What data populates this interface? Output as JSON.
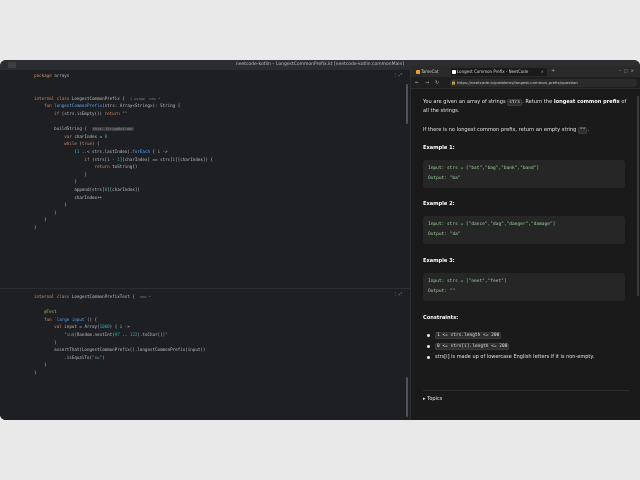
{
  "ide": {
    "window_title": "neetcode-kotlin – LongestCommonPrefix.kt [neetcode-kotlin.commonMain]",
    "top_hints": "1 usage  new *",
    "bottom_hints": "new *"
  },
  "code_top": [
    "package arrays",
    "",
    "",
    "internal class LongestCommonPrefix {",
    "    fun longestCommonPrefix(strs: Array<String>): String {",
    "        if (strs.isEmpty()) return \"\"",
    "",
    "        buildString {",
    "            var charIndex = 0",
    "            while (true) {",
    "                (1 ..< strs.lastIndex).forEach { i ->",
    "                    if (strs[i - 1][charIndex] == strs[i][charIndex]) {",
    "                        return toString()",
    "                    }",
    "                }",
    "                append(strs[0][charIndex])",
    "                charIndex++",
    "            }",
    "        }",
    "    }",
    "}"
  ],
  "code_bottom": [
    "internal class LongestCommonPrefixTest {",
    "",
    "    @Test",
    "    fun `large input`() {",
    "        val input = Array(1000) { i ->",
    "            \"su${Random.nextInt(97 .. 122).toChar()}\"",
    "        }",
    "        assertThat(LongestCommonPrefix().longestCommonPrefix(input))",
    "            .isEqualTo(\"su\")",
    "    }",
    "}"
  ],
  "browser": {
    "tabs": [
      {
        "label": "TameCat",
        "icon_color": "#f0a030"
      },
      {
        "label": "Longest Common Prefix - NeetCode",
        "icon_color": "#ffffff"
      }
    ],
    "url": "https://neetcode.io/problems/longest-common-prefix/question",
    "problem": {
      "intro_a": "You are given an array of strings ",
      "intro_code": "strs",
      "intro_b": ". Return the ",
      "intro_bold": "longest common prefix",
      "intro_c": " of all the strings.",
      "empty_a": "If there is no longest common prefix, return an empty string ",
      "empty_code": "\"\"",
      "empty_b": ".",
      "examples": [
        {
          "title": "Example 1:",
          "input": "Input: strs = [\"bat\",\"bag\",\"bank\",\"band\"]",
          "output": "Output: \"ba\""
        },
        {
          "title": "Example 2:",
          "input": "Input: strs = [\"dance\",\"dag\",\"danger\",\"damage\"]",
          "output": "Output: \"da\""
        },
        {
          "title": "Example 3:",
          "input": "Input: strs = [\"neet\",\"feet\"]",
          "output": "Output: \"\""
        }
      ],
      "constraints_title": "Constraints:",
      "constraints": [
        "1 <= strs.length <= 200",
        "0 <= strs[i].length <= 200",
        "strs[i] is made up of lowercase English letters if it is non-empty."
      ],
      "topics": "Topics"
    }
  }
}
